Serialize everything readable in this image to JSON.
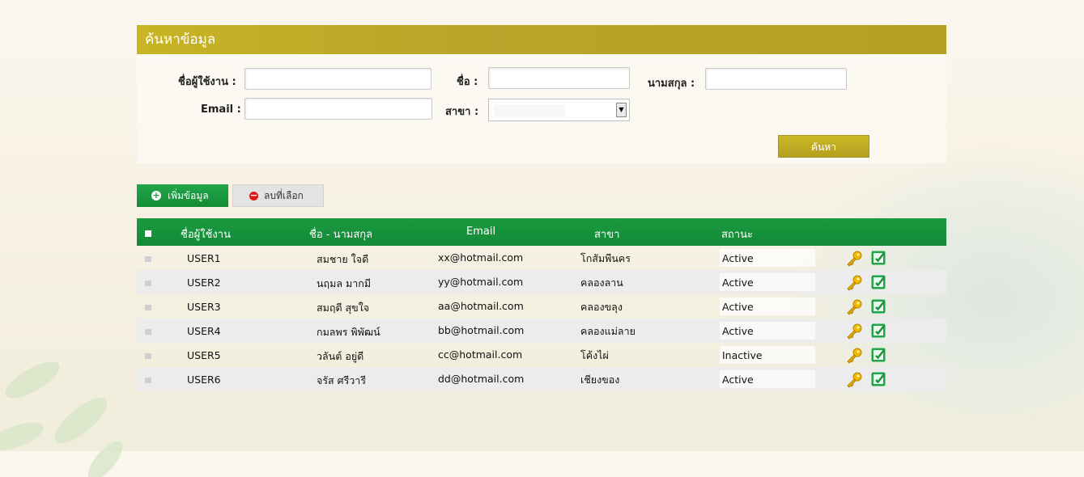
{
  "search": {
    "title": "ค้นหาข้อมูล",
    "username_label": "ชื่อผู้ใช้งาน :",
    "username_value": "",
    "firstname_label": "ชื่อ :",
    "firstname_value": "",
    "lastname_label": "นามสกุล :",
    "lastname_value": "",
    "email_label": "Email :",
    "email_value": "",
    "branch_label": "สาขา :",
    "branch_selected": "",
    "search_button": "ค้นหา"
  },
  "actions": {
    "add_button": "เพิ่มข้อมูล",
    "delete_button": "ลบที่เลือก"
  },
  "table": {
    "headers": [
      "ชื่อผู้ใช้งาน",
      "ชื่อ - นามสกุล",
      "Email",
      "สาขา",
      "สถานะ"
    ],
    "rows": [
      {
        "username": "USER1",
        "name": "สมชาย ใจดี",
        "email": "xx@hotmail.com",
        "branch": "โกสัมพีนคร",
        "status": "Active"
      },
      {
        "username": "USER2",
        "name": "นฤมล มากมี",
        "email": "yy@hotmail.com",
        "branch": "คลองลาน",
        "status": "Active"
      },
      {
        "username": "USER3",
        "name": "สมฤดี สุขใจ",
        "email": "aa@hotmail.com",
        "branch": "คลองขลุง",
        "status": "Active"
      },
      {
        "username": "USER4",
        "name": "กมลพร พิพัฒน์",
        "email": "bb@hotmail.com",
        "branch": "คลองแม่ลาย",
        "status": "Active"
      },
      {
        "username": "USER5",
        "name": "วลันต์ อยู่ดี",
        "email": "cc@hotmail.com",
        "branch": "โค้งไผ่",
        "status": "Inactive"
      },
      {
        "username": "USER6",
        "name": "จรัส ศรีวารี",
        "email": "dd@hotmail.com",
        "branch": "เชียงของ",
        "status": "Active"
      }
    ]
  },
  "icons": {
    "password": "key-icon",
    "edit": "edit-icon",
    "add": "plus-circle-icon",
    "delete": "minus-circle-icon"
  },
  "colors": {
    "header_gold": "#bfa927",
    "table_green": "#17923c",
    "delete_red": "#e01a1a"
  }
}
